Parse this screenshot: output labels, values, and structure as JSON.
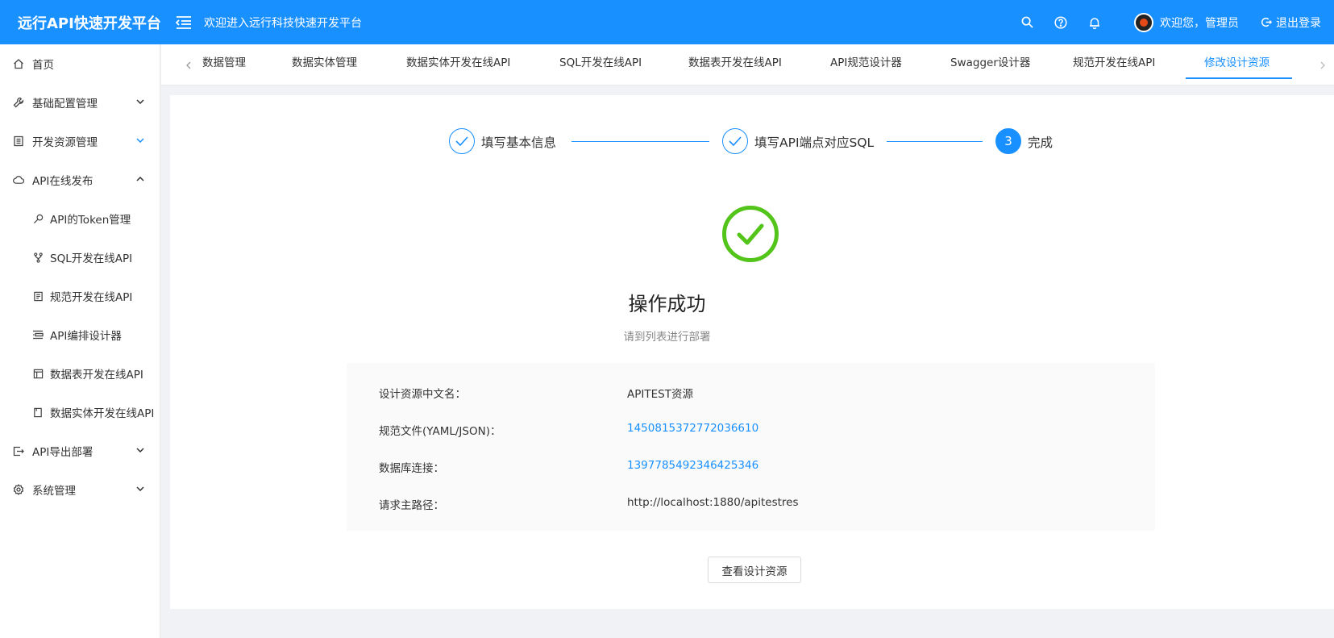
{
  "header": {
    "brand": "远行API快速开发平台",
    "welcome": "欢迎进入远行科技快速开发平台",
    "user_greeting": "欢迎您，管理员",
    "logout": "退出登录"
  },
  "sidebar": {
    "items": [
      {
        "label": "首页",
        "icon": "home-icon"
      },
      {
        "label": "基础配置管理",
        "icon": "wrench-icon",
        "arrow": "down"
      },
      {
        "label": "开发资源管理",
        "icon": "book-icon",
        "arrow": "down"
      },
      {
        "label": "API在线发布",
        "icon": "cloud-icon",
        "arrow": "up"
      },
      {
        "label": "API的Token管理",
        "icon": "key-icon"
      },
      {
        "label": "SQL开发在线API",
        "icon": "fork-icon"
      },
      {
        "label": "规范开发在线API",
        "icon": "document-icon"
      },
      {
        "label": "API编排设计器",
        "icon": "layout-icon"
      },
      {
        "label": "数据表开发在线API",
        "icon": "table-icon"
      },
      {
        "label": "数据实体开发在线API",
        "icon": "file-icon"
      },
      {
        "label": "API导出部署",
        "icon": "export-icon",
        "arrow": "down"
      },
      {
        "label": "系统管理",
        "icon": "gear-icon",
        "arrow": "down"
      }
    ]
  },
  "tabs": [
    {
      "label": "数据管理"
    },
    {
      "label": "数据实体管理"
    },
    {
      "label": "数据实体开发在线API"
    },
    {
      "label": "SQL开发在线API"
    },
    {
      "label": "数据表开发在线API"
    },
    {
      "label": "API规范设计器"
    },
    {
      "label": "Swagger设计器"
    },
    {
      "label": "规范开发在线API"
    },
    {
      "label": "修改设计资源"
    }
  ],
  "steps": [
    {
      "label": "填写基本信息",
      "status": "done"
    },
    {
      "label": "填写API端点对应SQL",
      "status": "done"
    },
    {
      "label": "完成",
      "number": "3",
      "status": "current"
    }
  ],
  "result": {
    "title": "操作成功",
    "subtitle": "请到列表进行部署"
  },
  "details": [
    {
      "label": "设计资源中文名：",
      "value": "APITEST资源"
    },
    {
      "label": "规范文件(YAML/JSON)：",
      "value": "1450815372772036610"
    },
    {
      "label": "数据库连接：",
      "value": "1397785492346425346"
    },
    {
      "label": "请求主路径：",
      "value": "http://localhost:1880/apitestres"
    }
  ],
  "view_button": "查看设计资源",
  "colors": {
    "primary": "#1890ff",
    "success": "#52c41a"
  }
}
